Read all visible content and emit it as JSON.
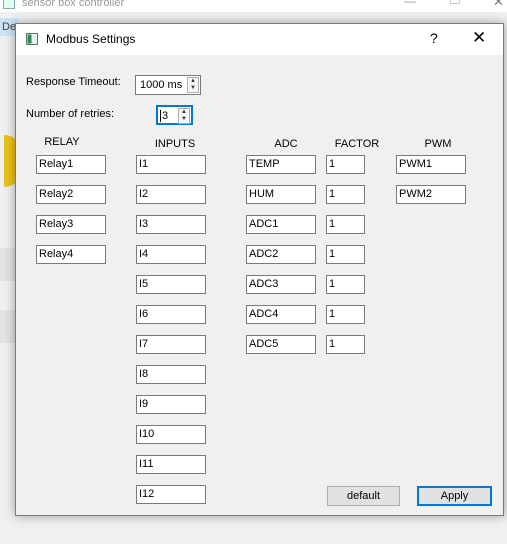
{
  "main_window": {
    "title": "sensor box controller",
    "menu_fragment": "De"
  },
  "dialog": {
    "title": "Modbus Settings",
    "help_label": "?",
    "close_label": "✕",
    "timeout": {
      "label": "Response Timeout:",
      "value": "1000 ms"
    },
    "retries": {
      "label": "Number of retries:",
      "value": "3"
    },
    "columns": {
      "relay": "RELAY",
      "inputs": "INPUTS",
      "adc": "ADC",
      "factor": "FACTOR",
      "pwm": "PWM"
    },
    "relays": [
      "Relay1",
      "Relay2",
      "Relay3",
      "Relay4"
    ],
    "inputs": [
      "I1",
      "I2",
      "I3",
      "I4",
      "I5",
      "I6",
      "I7",
      "I8",
      "I9",
      "I10",
      "I11",
      "I12"
    ],
    "adcs": [
      "TEMP",
      "HUM",
      "ADC1",
      "ADC2",
      "ADC3",
      "ADC4",
      "ADC5"
    ],
    "factors": [
      "1",
      "1",
      "1",
      "1",
      "1",
      "1",
      "1"
    ],
    "pwms": [
      "PWM1",
      "PWM2"
    ],
    "buttons": {
      "default_label": "default",
      "apply_label": "Apply"
    }
  },
  "colors": {
    "accent": "#0078d7",
    "background": "#f0f0f0",
    "field_border": "#7a7a7a"
  }
}
